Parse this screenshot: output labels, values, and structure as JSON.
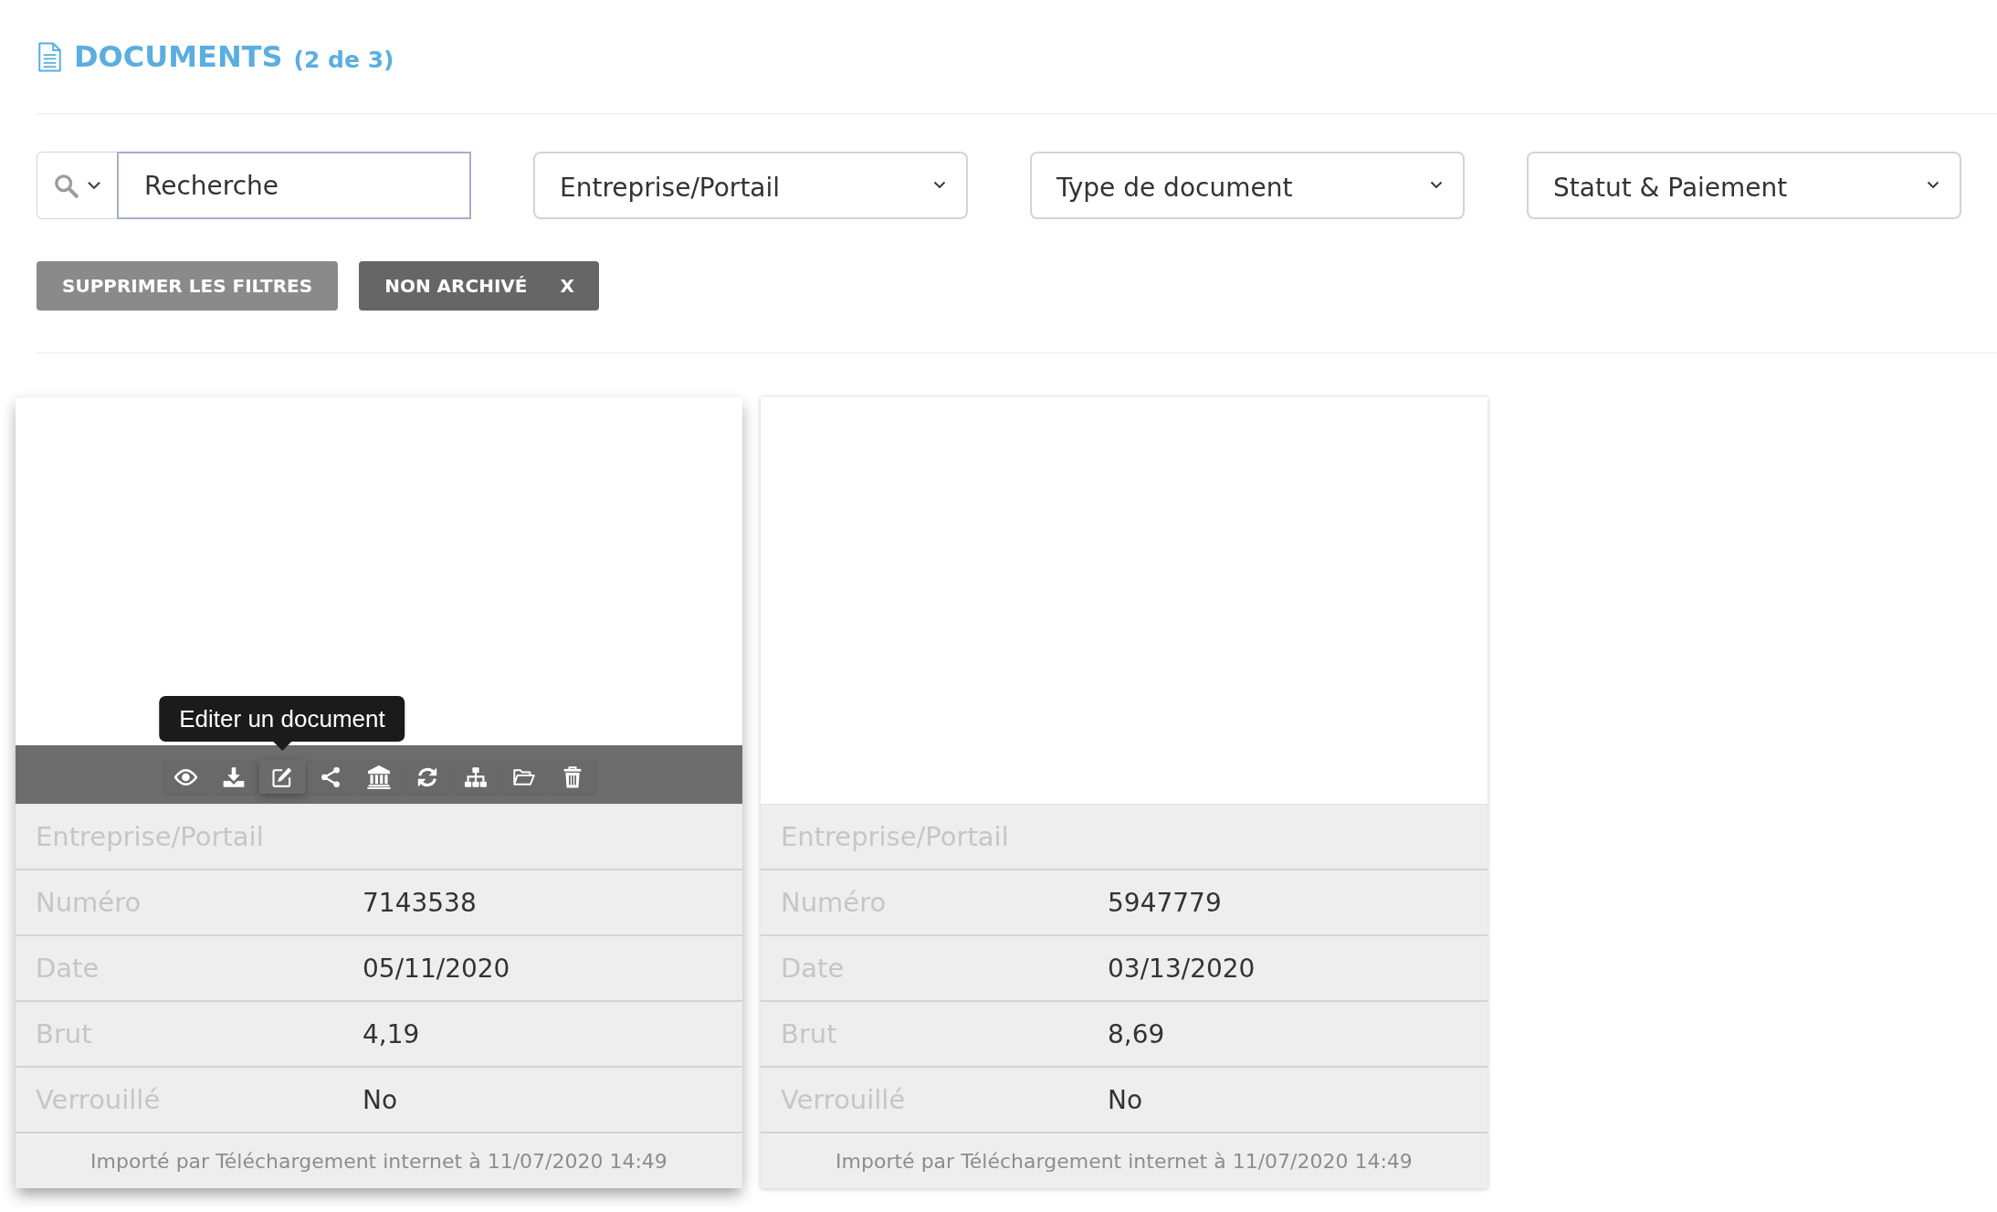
{
  "header": {
    "title": "DOCUMENTS",
    "count": "(2 de 3)"
  },
  "filters": {
    "search": {
      "placeholder": "Recherche"
    },
    "dropdowns": [
      {
        "label": "Entreprise/Portail"
      },
      {
        "label": "Type de document"
      },
      {
        "label": "Statut & Paiement"
      }
    ]
  },
  "actions": [
    {
      "kind": "clear",
      "label": "SUPPRIMER LES FILTRES"
    },
    {
      "kind": "tag",
      "label": "NON ARCHIVÉ",
      "remove": "X"
    }
  ],
  "cards": [
    {
      "hovered": true,
      "toolbar": [
        {
          "kind": "view",
          "hovered": false
        },
        {
          "kind": "download",
          "hovered": false
        },
        {
          "kind": "edit",
          "hovered": true,
          "tooltip": "Editer un document"
        },
        {
          "kind": "share",
          "hovered": false
        },
        {
          "kind": "bank",
          "hovered": false
        },
        {
          "kind": "refresh",
          "hovered": false
        },
        {
          "kind": "hierarchy",
          "hovered": false
        },
        {
          "kind": "folder",
          "hovered": false
        },
        {
          "kind": "delete",
          "hovered": false
        }
      ],
      "fields": [
        {
          "label": "Entreprise/Portail"
        },
        {
          "label": "Numéro",
          "value": "7143538"
        },
        {
          "label": "Date",
          "value": "05/11/2020"
        },
        {
          "label": "Brut",
          "value": "4,19"
        },
        {
          "label": "Verrouillé",
          "value": "No"
        }
      ],
      "footer": "Importé par Téléchargement internet à 11/07/2020 14:49"
    },
    {
      "hovered": false,
      "fields": [
        {
          "label": "Entreprise/Portail"
        },
        {
          "label": "Numéro",
          "value": "5947779"
        },
        {
          "label": "Date",
          "value": "03/13/2020"
        },
        {
          "label": "Brut",
          "value": "8,69"
        },
        {
          "label": "Verrouillé",
          "value": "No"
        }
      ],
      "footer": "Importé par Téléchargement internet à 11/07/2020 14:49"
    }
  ]
}
